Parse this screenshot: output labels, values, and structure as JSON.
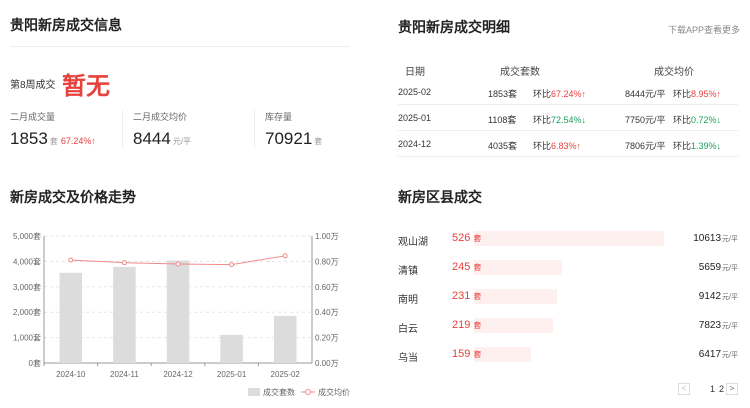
{
  "info": {
    "title": "贵阳新房成交信息",
    "week_label": "第8周成交",
    "week_value": "暂无",
    "stats": [
      {
        "label": "二月成交量",
        "value": "1853",
        "unit": "套",
        "change": "67.24%↑"
      },
      {
        "label": "二月成交均价",
        "value": "8444",
        "unit": "元/平",
        "change": ""
      },
      {
        "label": "库存量",
        "value": "70921",
        "unit": "套",
        "change": ""
      }
    ]
  },
  "detail": {
    "title": "贵阳新房成交明细",
    "download_link": "下载APP查看更多",
    "headers": [
      "日期",
      "成交套数",
      "成交均价"
    ],
    "rows": [
      {
        "date": "2025-02",
        "count": "1853套",
        "count_prefix": "环比",
        "count_change": "67.24%↑",
        "count_trend": "up",
        "price": "8444元/平",
        "price_prefix": "环比",
        "price_change": "8.95%↑",
        "price_trend": "up"
      },
      {
        "date": "2025-01",
        "count": "1108套",
        "count_prefix": "环比",
        "count_change": "72.54%↓",
        "count_trend": "down",
        "price": "7750元/平",
        "price_prefix": "环比",
        "price_change": "0.72%↓",
        "price_trend": "down"
      },
      {
        "date": "2024-12",
        "count": "4035套",
        "count_prefix": "环比",
        "count_change": "6.83%↑",
        "count_trend": "up",
        "price": "7806元/平",
        "price_prefix": "环比",
        "price_change": "1.39%↓",
        "price_trend": "down"
      }
    ]
  },
  "trend": {
    "title": "新房成交及价格走势"
  },
  "chart_data": {
    "type": "bar",
    "categories": [
      "2024-10",
      "2024-11",
      "2024-12",
      "2025-01",
      "2025-02"
    ],
    "series": [
      {
        "name": "成交套数",
        "type": "bar",
        "axis": "left",
        "values": [
          3550,
          3780,
          4035,
          1108,
          1853
        ]
      },
      {
        "name": "成交均价",
        "type": "line",
        "axis": "right",
        "values": [
          0.81,
          0.79,
          0.78,
          0.775,
          0.844
        ]
      }
    ],
    "y_left": {
      "min": 0,
      "max": 5000,
      "ticks": [
        "0套",
        "1,000套",
        "2,000套",
        "3,000套",
        "4,000套",
        "5,000套"
      ]
    },
    "y_right": {
      "min": 0,
      "max": 1,
      "ticks": [
        "0.00万",
        "0.20万",
        "0.40万",
        "0.60万",
        "0.80万",
        "1.00万"
      ]
    },
    "legend": [
      "成交套数",
      "成交均价"
    ],
    "legend_position": "bottom-right",
    "colors": {
      "bar": "#dcdcdc",
      "line": "#f08a8a"
    }
  },
  "district": {
    "title": "新房区县成交",
    "items": [
      {
        "name": "观山湖",
        "count": "526",
        "count_num": 526,
        "unit": "套",
        "price": "10613",
        "price_unit": "元/平"
      },
      {
        "name": "清镇",
        "count": "245",
        "count_num": 245,
        "unit": "套",
        "price": "5659",
        "price_unit": "元/平"
      },
      {
        "name": "南明",
        "count": "231",
        "count_num": 231,
        "unit": "套",
        "price": "9142",
        "price_unit": "元/平"
      },
      {
        "name": "白云",
        "count": "219",
        "count_num": 219,
        "unit": "套",
        "price": "7823",
        "price_unit": "元/平"
      },
      {
        "name": "乌当",
        "count": "159",
        "count_num": 159,
        "unit": "套",
        "price": "6417",
        "price_unit": "元/平"
      }
    ],
    "pager": {
      "prev": "<",
      "pages": [
        "1",
        "2"
      ],
      "next": ">"
    }
  }
}
